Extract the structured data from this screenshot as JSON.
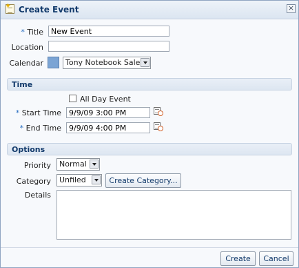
{
  "dialog": {
    "title": "Create Event",
    "close_glyph": "×"
  },
  "fields": {
    "required_marker": "*",
    "title_label": "Title",
    "title_value": "New Event",
    "location_label": "Location",
    "location_value": "",
    "calendar_label": "Calendar",
    "calendar_value": "Tony Notebook Sales",
    "calendar_color": "#7ba4d4"
  },
  "time": {
    "section_label": "Time",
    "all_day_label": "All Day Event",
    "all_day_checked": false,
    "start_label": "Start Time",
    "start_value": "9/9/09 3:00 PM",
    "end_label": "End Time",
    "end_value": "9/9/09 4:00 PM"
  },
  "options": {
    "section_label": "Options",
    "priority_label": "Priority",
    "priority_value": "Normal",
    "category_label": "Category",
    "category_value": "Unfiled",
    "create_category_label": "Create Category...",
    "details_label": "Details",
    "details_value": ""
  },
  "footer": {
    "create_label": "Create",
    "cancel_label": "Cancel"
  },
  "icons": {
    "title_icon": "new-event-icon",
    "date_picker": "calendar-clock-icon"
  }
}
